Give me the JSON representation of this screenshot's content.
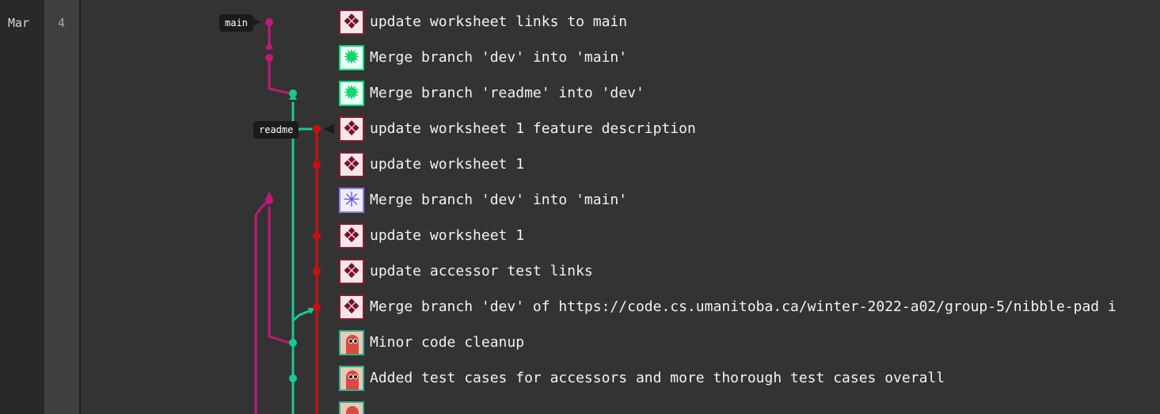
{
  "date_gutter": {
    "month": "Mar",
    "day": "4"
  },
  "branch_labels": {
    "main": "main",
    "readme": "readme"
  },
  "colors": {
    "main_lane": "#c2187a",
    "readme_lane": "#17c995",
    "dev_lane": "#c81010",
    "text": "#f2f2f2",
    "background": "#333333"
  },
  "commits": [
    {
      "message": "update worksheet links to main",
      "avatar": "maroon",
      "avatar_icon": "identicon"
    },
    {
      "message": "Merge branch 'dev' into 'main'",
      "avatar": "green",
      "avatar_icon": "identicon"
    },
    {
      "message": "Merge branch 'readme' into 'dev'",
      "avatar": "green",
      "avatar_icon": "identicon"
    },
    {
      "message": "update worksheet 1 feature description",
      "avatar": "maroon",
      "avatar_icon": "identicon"
    },
    {
      "message": "update worksheet 1",
      "avatar": "maroon",
      "avatar_icon": "identicon"
    },
    {
      "message": "Merge branch 'dev' into 'main'",
      "avatar": "blue",
      "avatar_icon": "identicon"
    },
    {
      "message": "update worksheet 1",
      "avatar": "maroon",
      "avatar_icon": "identicon"
    },
    {
      "message": "update accessor test links",
      "avatar": "maroon",
      "avatar_icon": "identicon"
    },
    {
      "message": "Merge branch 'dev' of https://code.cs.umanitoba.ca/winter-2022-a02/group-5/nibble-pad i",
      "avatar": "maroon",
      "avatar_icon": "identicon"
    },
    {
      "message": "Minor code cleanup",
      "avatar": "photo",
      "avatar_icon": "user-photo"
    },
    {
      "message": "Added test cases for accessors and more thorough test cases overall",
      "avatar": "photo",
      "avatar_icon": "user-photo"
    }
  ]
}
